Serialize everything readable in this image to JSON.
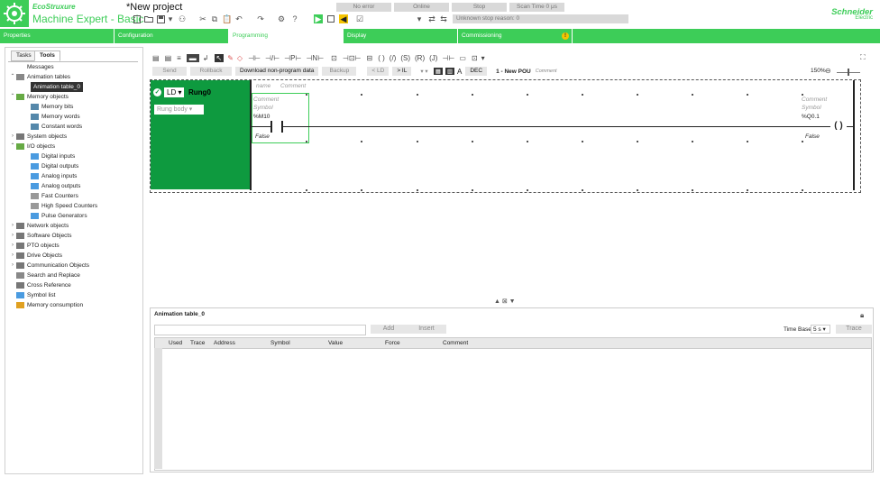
{
  "header": {
    "brand": "EcoStruxure",
    "product": "Machine Expert - Basic",
    "project_title": "*New project",
    "status": {
      "error": "No error",
      "online": "Online",
      "stop": "Stop",
      "scan_time": "Scan Time 0 μs",
      "stop_reason": "Unknown stop reason: 0"
    },
    "vendor_line1": "Schneider",
    "vendor_line2": "Electric"
  },
  "nav": {
    "tabs": [
      {
        "label": "Properties",
        "active": false
      },
      {
        "label": "Configuration",
        "active": false
      },
      {
        "label": "Programming",
        "active": true
      },
      {
        "label": "Display",
        "active": false
      },
      {
        "label": "Commissioning",
        "active": false
      }
    ],
    "warning_badge": "!"
  },
  "left_panel": {
    "tabs": [
      "Tasks",
      "Tools"
    ],
    "tree": [
      {
        "label": "Messages",
        "level": 0,
        "expander": "",
        "icon": ""
      },
      {
        "label": "Animation tables",
        "level": 0,
        "expander": "⌃",
        "icon": "search"
      },
      {
        "label": "Animation table_0",
        "level": 1,
        "expander": "",
        "icon": "",
        "selected": true
      },
      {
        "label": "Memory objects",
        "level": 0,
        "expander": "⌃",
        "icon": "memory"
      },
      {
        "label": "Memory bits",
        "level": 1,
        "expander": "",
        "icon": "bits"
      },
      {
        "label": "Memory words",
        "level": 1,
        "expander": "",
        "icon": "words"
      },
      {
        "label": "Constant words",
        "level": 1,
        "expander": "",
        "icon": "words"
      },
      {
        "label": "System objects",
        "level": 0,
        "expander": "›",
        "icon": "gear"
      },
      {
        "label": "I/O objects",
        "level": 0,
        "expander": "⌃",
        "icon": "io"
      },
      {
        "label": "Digital inputs",
        "level": 1,
        "expander": "",
        "icon": "din"
      },
      {
        "label": "Digital outputs",
        "level": 1,
        "expander": "",
        "icon": "dout"
      },
      {
        "label": "Analog inputs",
        "level": 1,
        "expander": "",
        "icon": "ain"
      },
      {
        "label": "Analog outputs",
        "level": 1,
        "expander": "",
        "icon": "aout"
      },
      {
        "label": "Fast Counters",
        "level": 1,
        "expander": "",
        "icon": "counter"
      },
      {
        "label": "High Speed Counters",
        "level": 1,
        "expander": "",
        "icon": "counter"
      },
      {
        "label": "Pulse Generators",
        "level": 1,
        "expander": "",
        "icon": "pulse"
      },
      {
        "label": "Network objects",
        "level": 0,
        "expander": "›",
        "icon": "network"
      },
      {
        "label": "Software Objects",
        "level": 0,
        "expander": "›",
        "icon": "software"
      },
      {
        "label": "PTO objects",
        "level": 0,
        "expander": "›",
        "icon": "pto"
      },
      {
        "label": "Drive Objects",
        "level": 0,
        "expander": "›",
        "icon": "drive"
      },
      {
        "label": "Communication Objects",
        "level": 0,
        "expander": "›",
        "icon": "comm"
      },
      {
        "label": "Search and Replace",
        "level": 0,
        "expander": "",
        "icon": "search"
      },
      {
        "label": "Cross Reference",
        "level": 0,
        "expander": "",
        "icon": "xref"
      },
      {
        "label": "Symbol list",
        "level": 0,
        "expander": "",
        "icon": "list"
      },
      {
        "label": "Memory consumption",
        "level": 0,
        "expander": "",
        "icon": "chart"
      }
    ]
  },
  "editor": {
    "buttons": {
      "send": "Send",
      "rollback": "Rollback",
      "download": "Download non-program data",
      "backup": "Backup",
      "ld": "< LD",
      "il": "> IL",
      "dec": "DEC"
    },
    "pou_title": "1 - New POU",
    "pou_comment": "Comment",
    "zoom": "150%"
  },
  "rung": {
    "mode": "LD",
    "name": "Rung0",
    "body_select": "Rung body",
    "name_hint": "name",
    "comment_hint": "Comment",
    "contact": {
      "comment": "Comment",
      "symbol": "Symbol",
      "address": "%M10",
      "value": "False"
    },
    "coil": {
      "comment": "Comment",
      "symbol": "Symbol",
      "address": "%Q0.1",
      "value": "False"
    }
  },
  "animation_table": {
    "title": "Animation table_0",
    "add": "Add",
    "insert": "Insert",
    "time_base_label": "Time Base",
    "time_base_value": "5 s",
    "trace": "Trace",
    "columns": [
      "Used",
      "Trace",
      "Address",
      "Symbol",
      "Value",
      "Force",
      "Comment"
    ]
  },
  "colors": {
    "accent": "#3dcd58",
    "rung_green": "#0e9a3f",
    "warning": "#f5c400"
  }
}
